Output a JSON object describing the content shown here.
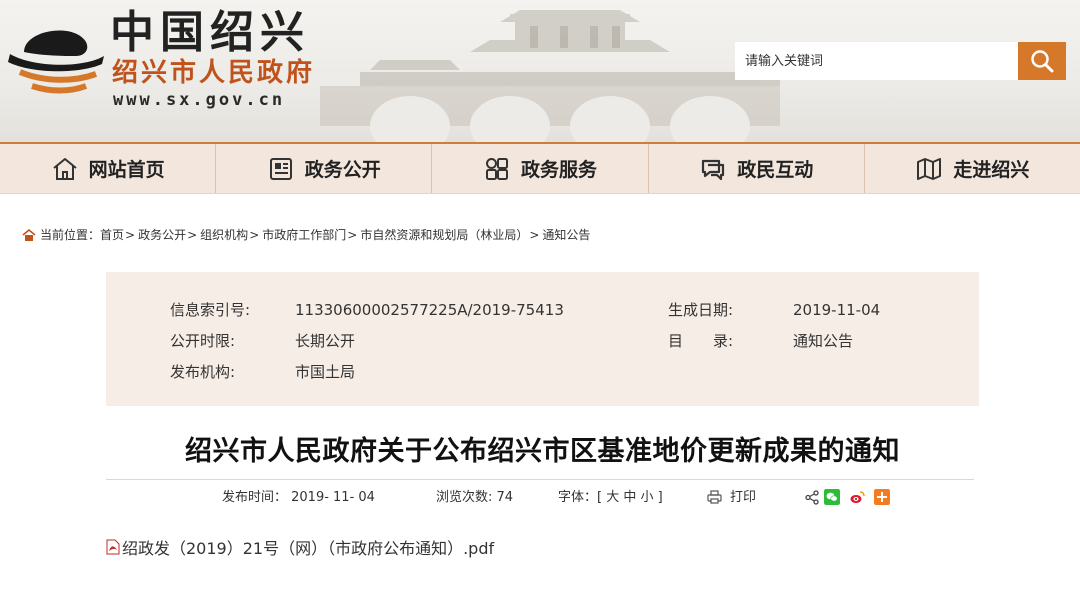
{
  "header": {
    "site_title": "中国绍兴",
    "site_subtitle": "绍兴市人民政府",
    "site_url": "www.sx.gov.cn",
    "search_placeholder": "请输入关键词",
    "accent_color": "#d5782a"
  },
  "nav": {
    "items": [
      {
        "label": "网站首页",
        "icon": "home-icon"
      },
      {
        "label": "政务公开",
        "icon": "document-icon"
      },
      {
        "label": "政务服务",
        "icon": "grid-icon"
      },
      {
        "label": "政民互动",
        "icon": "chat-icon"
      },
      {
        "label": "走进绍兴",
        "icon": "map-icon"
      }
    ]
  },
  "breadcrumb": {
    "prefix": "当前位置：",
    "items": [
      "首页",
      "政务公开",
      "组织机构",
      "市政府工作部门",
      "市自然资源和规划局（林业局）",
      "通知公告"
    ]
  },
  "info": {
    "index_label": "信息索引号:",
    "index_value": "11330600002577225A/2019-75413",
    "date_label": "生成日期:",
    "date_value": "2019-11-04",
    "period_label": "公开时限:",
    "period_value": "长期公开",
    "catalog_label": "目　　录:",
    "catalog_value": "通知公告",
    "org_label": "发布机构:",
    "org_value": "市国土局"
  },
  "article": {
    "title": "绍兴市人民政府关于公布绍兴市区基准地价更新成果的通知",
    "publish_time": "发布时间： 2019- 11- 04",
    "views": "浏览次数: 74",
    "font_size": "字体：[ 大 中 小 ]",
    "print_label": "打印",
    "attachment": "绍政发（2019）21号（网）（市政府公布通知）.pdf"
  }
}
